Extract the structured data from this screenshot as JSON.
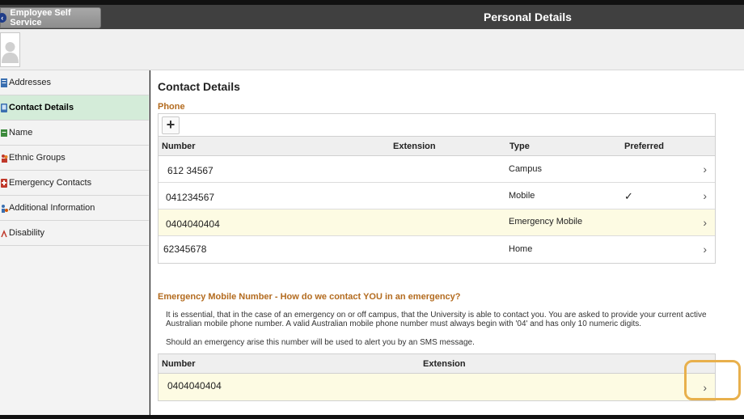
{
  "header": {
    "back_label": "Employee Self Service",
    "title": "Personal Details"
  },
  "sidebar": {
    "items": [
      {
        "label": "Addresses",
        "icon": "address-icon",
        "color": "#3a6fb0",
        "selected": false
      },
      {
        "label": "Contact Details",
        "icon": "phone-icon",
        "color": "#3a6fb0",
        "selected": true
      },
      {
        "label": "Name",
        "icon": "name-icon",
        "color": "#3c8a3c",
        "selected": false
      },
      {
        "label": "Ethnic Groups",
        "icon": "ethnic-groups-icon",
        "color": "#c0392b",
        "selected": false
      },
      {
        "label": "Emergency Contacts",
        "icon": "emergency-contacts-icon",
        "color": "#c0392b",
        "selected": false
      },
      {
        "label": "Additional Information",
        "icon": "additional-info-icon",
        "color": "#d35400",
        "selected": false
      },
      {
        "label": "Disability",
        "icon": "disability-icon",
        "color": "#c0392b",
        "selected": false
      }
    ]
  },
  "main": {
    "title": "Contact Details",
    "phone": {
      "title": "Phone",
      "add_label": "+",
      "columns": {
        "number": "Number",
        "extension": "Extension",
        "type": "Type",
        "preferred": "Preferred"
      },
      "rows": [
        {
          "number": "612 34567",
          "extension": "",
          "type": "Campus",
          "preferred": "",
          "highlight": false
        },
        {
          "number": "041234567",
          "extension": "",
          "type": "Mobile",
          "preferred": "✓",
          "highlight": false
        },
        {
          "number": "0404040404",
          "extension": "",
          "type": "Emergency Mobile",
          "preferred": "",
          "highlight": true
        },
        {
          "number": "62345678",
          "extension": "",
          "type": "Home",
          "preferred": "",
          "highlight": false
        }
      ]
    },
    "emergency": {
      "title": "Emergency Mobile Number - How do we contact YOU in an emergency?",
      "desc1": "It is essential, that in the case of an emergency on or off campus, that the University is able to contact you. You are asked to provide your current active Australian mobile phone number. A valid Australian mobile phone number must always begin with '04' and has only 10 numeric digits.",
      "desc2": "Should an emergency arise this number will be used to alert you by an SMS message.",
      "columns": {
        "number": "Number",
        "extension": "Extension"
      },
      "row": {
        "number": "0404040404",
        "extension": ""
      }
    },
    "chevron": "›"
  },
  "colors": {
    "header": "#404040",
    "selected_nav": "#d4ecd9",
    "subtitle": "#b36b1f",
    "row_highlight": "#fdfbe3",
    "focus": "#e8b04c"
  }
}
